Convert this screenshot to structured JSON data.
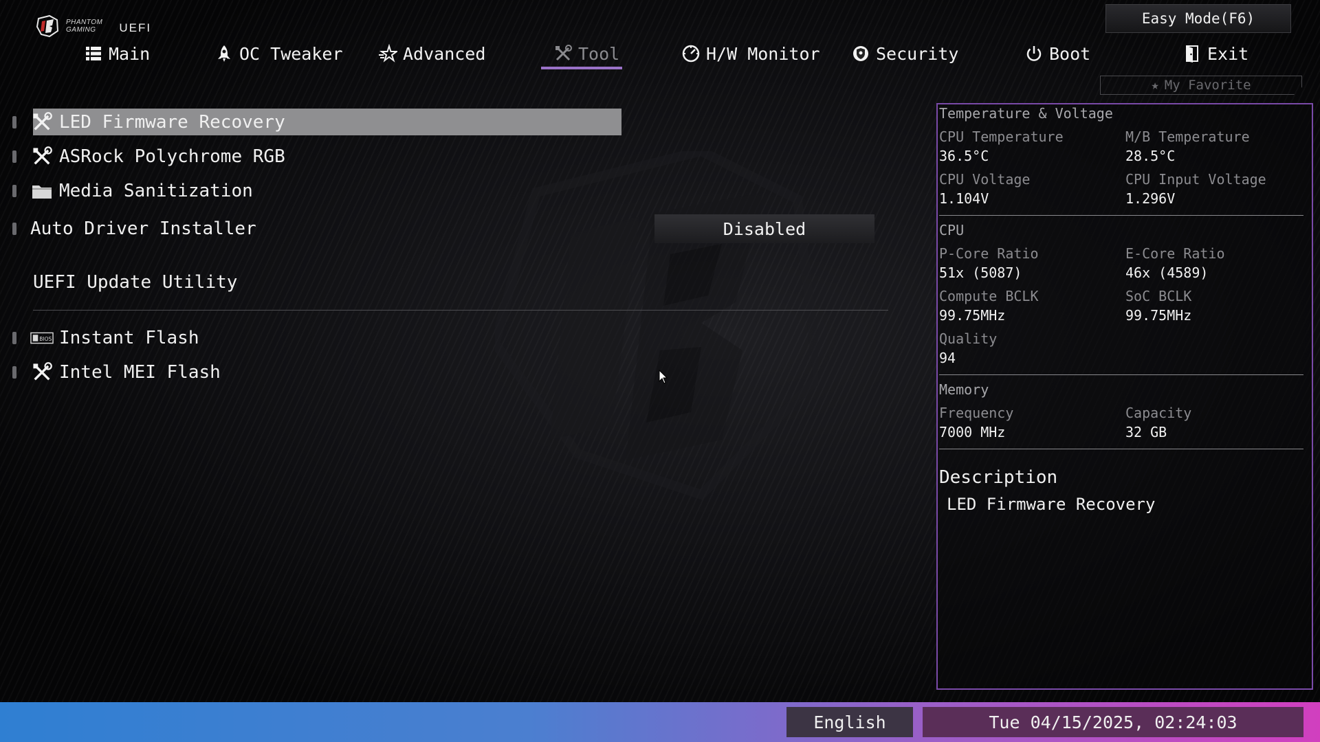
{
  "header": {
    "brand_line1": "PHANTOM",
    "brand_line2": "GAMING",
    "uefi_label": "UEFI",
    "easy_mode_label": "Easy Mode(F6)",
    "favorite_label": "My Favorite"
  },
  "tabs": [
    {
      "label": "Main",
      "icon": "list-icon"
    },
    {
      "label": "OC Tweaker",
      "icon": "rocket-icon"
    },
    {
      "label": "Advanced",
      "icon": "star-icon"
    },
    {
      "label": "Tool",
      "icon": "tools-icon",
      "active": true
    },
    {
      "label": "H/W Monitor",
      "icon": "gauge-icon"
    },
    {
      "label": "Security",
      "icon": "shield-icon"
    },
    {
      "label": "Boot",
      "icon": "power-icon"
    },
    {
      "label": "Exit",
      "icon": "exit-door-icon"
    }
  ],
  "menu": {
    "items": [
      {
        "label": "LED Firmware Recovery",
        "icon": "tools-icon",
        "selected": true
      },
      {
        "label": "ASRock Polychrome RGB",
        "icon": "tools-icon"
      },
      {
        "label": "Media Sanitization",
        "icon": "folder-icon"
      },
      {
        "label": "Auto Driver Installer",
        "value": "Disabled"
      }
    ],
    "section_title": "UEFI Update Utility",
    "section_items": [
      {
        "label": "Instant Flash",
        "icon": "bios-chip-icon"
      },
      {
        "label": "Intel MEI Flash",
        "icon": "tools-icon"
      }
    ]
  },
  "panel": {
    "temp_volt_title": "Temperature & Voltage",
    "cpu_temp_label": "CPU Temperature",
    "cpu_temp_value": "36.5°C",
    "mb_temp_label": "M/B Temperature",
    "mb_temp_value": "28.5°C",
    "cpu_volt_label": "CPU Voltage",
    "cpu_volt_value": "1.104V",
    "cpu_input_volt_label": "CPU Input Voltage",
    "cpu_input_volt_value": "1.296V",
    "cpu_title": "CPU",
    "pcore_label": "P-Core Ratio",
    "pcore_value": "51x (5087)",
    "ecore_label": "E-Core Ratio",
    "ecore_value": "46x (4589)",
    "compute_bclk_label": "Compute BCLK",
    "compute_bclk_value": "99.75MHz",
    "soc_bclk_label": "SoC BCLK",
    "soc_bclk_value": "99.75MHz",
    "quality_label": "Quality",
    "quality_value": "94",
    "memory_title": "Memory",
    "freq_label": "Frequency",
    "freq_value": "7000 MHz",
    "capacity_label": "Capacity",
    "capacity_value": "32 GB",
    "description_title": "Description",
    "description_text": "LED Firmware Recovery"
  },
  "footer": {
    "language": "English",
    "datetime": "Tue 04/15/2025, 02:24:03"
  },
  "colors": {
    "accent_purple": "#7a4aa8",
    "tab_underline": "#9a72c8",
    "selection_bg": "#8f8f91"
  }
}
